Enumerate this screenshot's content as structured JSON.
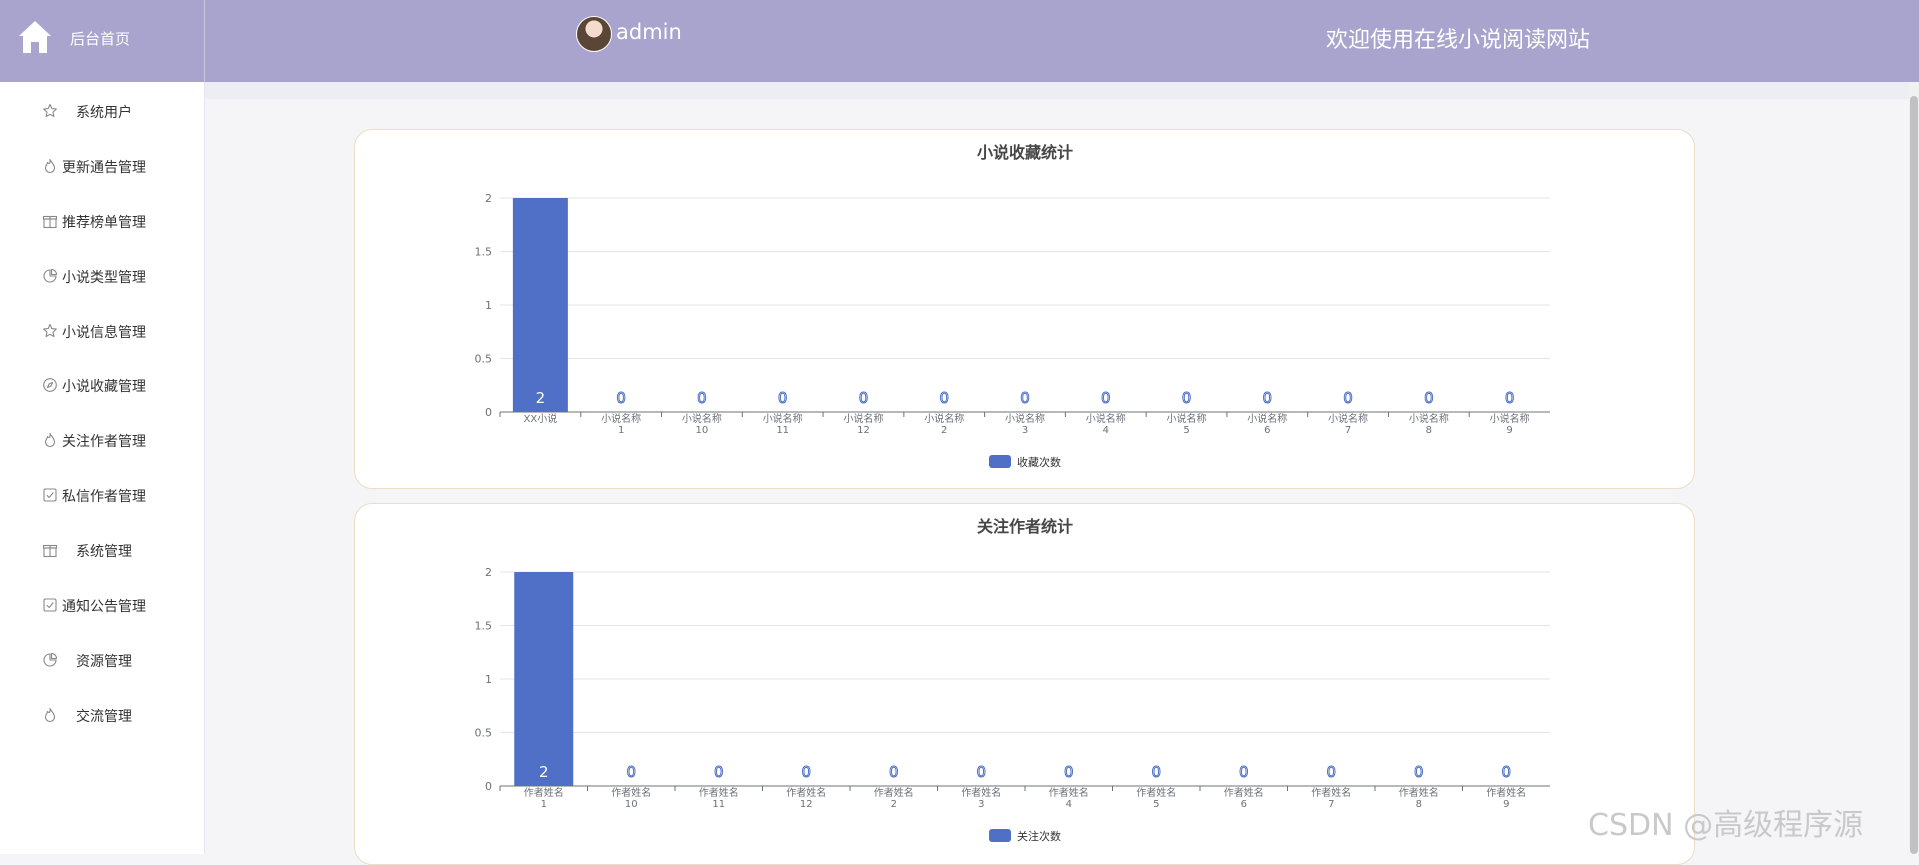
{
  "header": {
    "brand_label": "后台首页",
    "username": "admin",
    "welcome": "欢迎使用在线小说阅读网站",
    "bg_color": "#a8a4cd"
  },
  "sidebar": {
    "items": [
      {
        "label": "系统用户",
        "icon": "star-icon"
      },
      {
        "label": "更新通告管理",
        "icon": "fire-icon"
      },
      {
        "label": "推荐榜单管理",
        "icon": "gift-icon"
      },
      {
        "label": "小说类型管理",
        "icon": "pie-chart-icon"
      },
      {
        "label": "小说信息管理",
        "icon": "star-icon"
      },
      {
        "label": "小说收藏管理",
        "icon": "compass-icon"
      },
      {
        "label": "关注作者管理",
        "icon": "fire-icon"
      },
      {
        "label": "私信作者管理",
        "icon": "check-square-icon"
      },
      {
        "label": "系统管理",
        "icon": "gift-icon"
      },
      {
        "label": "通知公告管理",
        "icon": "check-square-icon"
      },
      {
        "label": "资源管理",
        "icon": "pie-chart-icon"
      },
      {
        "label": "交流管理",
        "icon": "fire-icon"
      }
    ]
  },
  "chart_data": [
    {
      "type": "bar",
      "title": "小说收藏统计",
      "categories": [
        "XX小说",
        "小说名称1",
        "小说名称10",
        "小说名称11",
        "小说名称12",
        "小说名称2",
        "小说名称3",
        "小说名称4",
        "小说名称5",
        "小说名称6",
        "小说名称7",
        "小说名称8",
        "小说名称9"
      ],
      "series": [
        {
          "name": "收藏次数",
          "values": [
            2,
            0,
            0,
            0,
            0,
            0,
            0,
            0,
            0,
            0,
            0,
            0,
            0
          ]
        }
      ],
      "ylim": [
        0,
        2
      ],
      "yticks": [
        "0",
        "0.5",
        "1",
        "1.5",
        "2"
      ],
      "grid": true,
      "legend": "bottom-center",
      "color": "#5070c8"
    },
    {
      "type": "bar",
      "title": "关注作者统计",
      "categories": [
        "作者姓名1",
        "作者姓名10",
        "作者姓名11",
        "作者姓名12",
        "作者姓名2",
        "作者姓名3",
        "作者姓名4",
        "作者姓名5",
        "作者姓名6",
        "作者姓名7",
        "作者姓名8",
        "作者姓名9"
      ],
      "series": [
        {
          "name": "关注次数",
          "values": [
            2,
            0,
            0,
            0,
            0,
            0,
            0,
            0,
            0,
            0,
            0,
            0
          ]
        }
      ],
      "ylim": [
        0,
        2
      ],
      "yticks": [
        "0",
        "0.5",
        "1",
        "1.5",
        "2"
      ],
      "grid": true,
      "legend": "bottom-center",
      "color": "#5070c8"
    }
  ],
  "watermark": "CSDN @高级程序源"
}
